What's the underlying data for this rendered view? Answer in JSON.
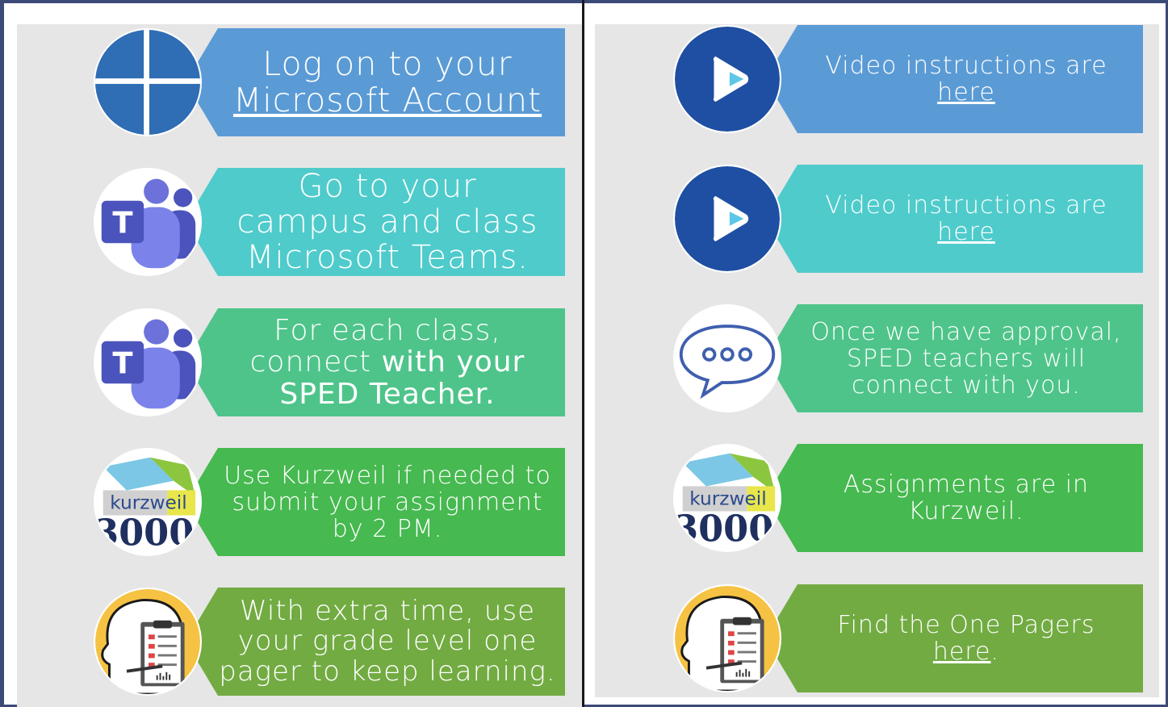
{
  "colors": {
    "blue": "#5b9bd5",
    "teal": "#4fcbcb",
    "green_light": "#4ec48a",
    "green": "#46b950",
    "green_olive": "#72ab42",
    "frame": "#3c4a78",
    "panel": "#e6e6e6"
  },
  "left_steps": [
    {
      "icon": "windows-icon",
      "text1": "Log on to your",
      "link": "Microsoft Account"
    },
    {
      "icon": "teams-icon",
      "line1": "Go to your",
      "line2": "campus and class",
      "line3": "Microsoft Teams."
    },
    {
      "icon": "teams-icon",
      "line1": "For each class,",
      "line2a": "connect ",
      "line2b": "with your",
      "line3": "SPED Teacher."
    },
    {
      "icon": "kurzweil-icon",
      "line1": "Use Kurzweil if needed to",
      "line2": "submit your assignment",
      "line3": "by 2 PM."
    },
    {
      "icon": "one-pager-icon",
      "line1": "With extra time, use",
      "line2": "your grade level one",
      "line3": "pager to keep learning."
    }
  ],
  "right_steps": [
    {
      "icon": "play-icon",
      "line1": "Video instructions are",
      "link": "here"
    },
    {
      "icon": "play-icon",
      "line1": "Video instructions are",
      "link": "here"
    },
    {
      "icon": "chat-bubble-icon",
      "line1": "Once we have approval,",
      "line2": "SPED teachers will",
      "line3": "connect with you."
    },
    {
      "icon": "kurzweil-icon",
      "line1": "Assignments are in",
      "line2": "Kurzweil."
    },
    {
      "icon": "one-pager-icon",
      "line1": "Find the One Pagers",
      "link": "here",
      "tail": "."
    }
  ],
  "kurzweil": {
    "brand": "kurzweil",
    "number": "3000"
  }
}
